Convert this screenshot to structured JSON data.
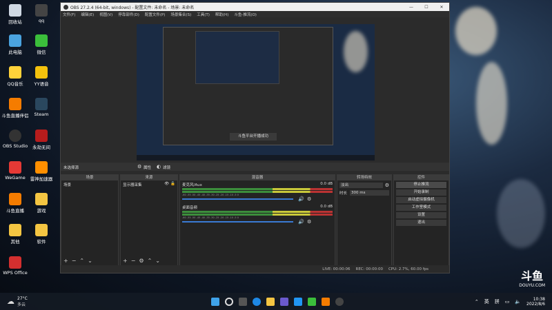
{
  "desktop_icons": [
    {
      "label": "回收站",
      "color": "#cfd8e3"
    },
    {
      "label": "qq",
      "color": "#444"
    },
    {
      "label": "此电脑",
      "color": "#4aa3df"
    },
    {
      "label": "微信",
      "color": "#3bbf3b"
    },
    {
      "label": "QQ音乐",
      "color": "#ffd23a"
    },
    {
      "label": "YY语音",
      "color": "#f4c20d"
    },
    {
      "label": "斗鱼直播伴侣",
      "color": "#f57c00"
    },
    {
      "label": "Steam",
      "color": "#2a475e"
    },
    {
      "label": "OBS Studio",
      "color": "#333"
    },
    {
      "label": "永劫无间",
      "color": "#b71c1c"
    },
    {
      "label": "WeGame",
      "color": "#e53935"
    },
    {
      "label": "雷神加速器",
      "color": "#ff8f00"
    },
    {
      "label": "斗鱼直播",
      "color": "#f57c00"
    },
    {
      "label": "游戏",
      "color": "#f4c542"
    },
    {
      "label": "其他",
      "color": "#f4c542"
    },
    {
      "label": "软件",
      "color": "#f4c542"
    },
    {
      "label": "WPS Office",
      "color": "#d32f2f"
    }
  ],
  "window": {
    "title": "OBS 27.2.4 (64-bit, windows) - 配置文件: 未命名 - 场景: 未命名",
    "min": "—",
    "max": "☐",
    "close": "✕"
  },
  "menu": [
    "文件(F)",
    "编辑(E)",
    "视图(V)",
    "停靠部件(D)",
    "配置文件(P)",
    "场景集合(S)",
    "工具(T)",
    "帮助(H)",
    "斗鱼-推流(O)"
  ],
  "preview": {
    "toast": "斗鱼平台开播成功"
  },
  "source_bar": {
    "no_source": "未选择源",
    "props": "属性",
    "filters": "滤镜"
  },
  "docks": {
    "scenes": {
      "title": "场景",
      "items": [
        "场景"
      ]
    },
    "sources": {
      "title": "来源",
      "items": [
        "显示器采集"
      ]
    },
    "mixer": {
      "title": "混音器",
      "channels": [
        {
          "name": "麦克风/Aux",
          "db": "0.0 dB"
        },
        {
          "name": "桌面音频",
          "db": "0.0 dB"
        }
      ],
      "scale": "-60 -55 -50 -45 -40 -35 -30 -25 -20 -15 -10 -5 0"
    },
    "transitions": {
      "title": "转场特效",
      "type": "淡出",
      "duration_label": "时长",
      "duration": "300 ms"
    },
    "controls": {
      "title": "控件",
      "buttons": [
        "停止推流",
        "开始录制",
        "启动虚拟摄像机",
        "工作室模式",
        "设置",
        "退出"
      ]
    }
  },
  "status": {
    "live": "LIVE: 00:00:06",
    "rec": "REC: 00:00:00",
    "cpu": "CPU: 2.7%, 60.00 fps"
  },
  "taskbar": {
    "weather_temp": "27°C",
    "weather_desc": "多云",
    "ime_lang": "英",
    "ime_mode": "拼",
    "time": "10:38",
    "date": "2022/8/6"
  },
  "watermark": {
    "brand": "斗鱼",
    "site": "DOUYU.COM"
  }
}
